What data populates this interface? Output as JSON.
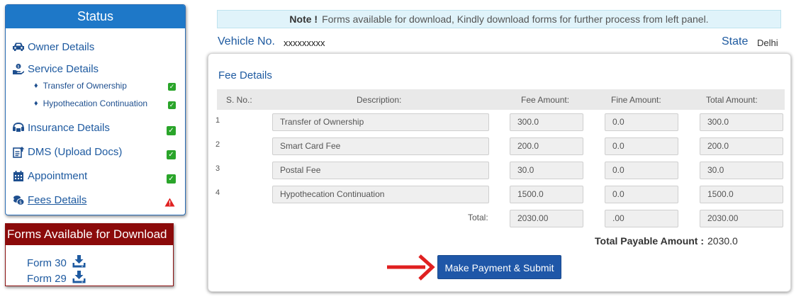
{
  "status": {
    "title": "Status",
    "items": [
      {
        "label": "Owner Details",
        "icon": "car-icon"
      },
      {
        "label": "Service Details",
        "icon": "service-hand-icon"
      },
      {
        "label": "Transfer of Ownership",
        "sub": true,
        "status": "done"
      },
      {
        "label": "Hypothecation Continuation",
        "sub": true,
        "status": "done"
      },
      {
        "label": "Insurance Details",
        "icon": "insurance-icon",
        "status": "done"
      },
      {
        "label": "DMS (Upload Docs)",
        "icon": "upload-docs-icon",
        "status": "done"
      },
      {
        "label": "Appointment",
        "icon": "calendar-icon",
        "status": "done"
      },
      {
        "label": "Fees Details",
        "icon": "coins-icon",
        "status": "warning"
      }
    ]
  },
  "forms": {
    "title": "Forms Available for Download",
    "items": [
      {
        "label": "Form 30",
        "icon": "download-icon"
      },
      {
        "label": "Form 29",
        "icon": "download-icon"
      }
    ]
  },
  "note": {
    "prefix": "Note !",
    "text": "Forms available for download, Kindly download forms for further process from left panel."
  },
  "vehicle": {
    "label": "Vehicle No.",
    "value": "xxxxxxxxx"
  },
  "state": {
    "label": "State",
    "value": "Delhi"
  },
  "fee": {
    "title": "Fee Details",
    "headers": [
      "S. No.:",
      "Description:",
      "Fee Amount:",
      "Fine Amount:",
      "Total Amount:"
    ],
    "rows": [
      {
        "sno": "1",
        "description": "Transfer of Ownership",
        "fee": "300.0",
        "fine": "0.0",
        "total": "300.0"
      },
      {
        "sno": "2",
        "description": "Smart Card Fee",
        "fee": "200.0",
        "fine": "0.0",
        "total": "200.0"
      },
      {
        "sno": "3",
        "description": "Postal Fee",
        "fee": "30.0",
        "fine": "0.0",
        "total": "30.0"
      },
      {
        "sno": "4",
        "description": "Hypothecation Continuation",
        "fee": "1500.0",
        "fine": "0.0",
        "total": "1500.0"
      }
    ],
    "total_label": "Total:",
    "totals": {
      "fee": "2030.00",
      "fine": ".00",
      "total": "2030.00"
    },
    "payable_label": "Total Payable Amount :",
    "payable_value": "2030.0",
    "submit_label": "Make Payment & Submit"
  },
  "colors": {
    "primary": "#1e78c8",
    "forms_header": "#8b0a0a",
    "check": "#2aa52a",
    "warning": "#e02020",
    "button": "#1f57a8",
    "arrow": "#e02020"
  }
}
